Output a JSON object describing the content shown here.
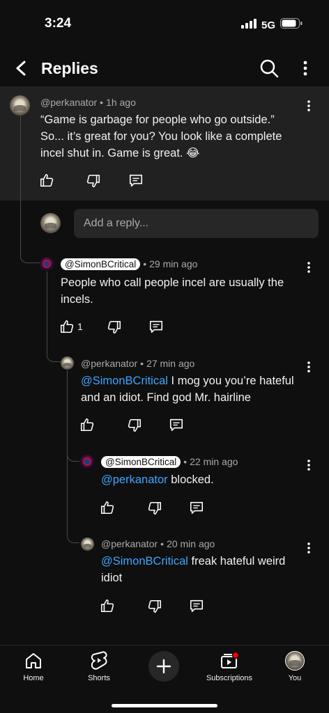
{
  "status": {
    "time": "3:24",
    "network": "5G"
  },
  "header": {
    "title": "Replies"
  },
  "top_comment": {
    "author": "@perkanator",
    "time": "1h ago",
    "lines": [
      "“Game is garbage for people who go outside.”",
      "So... it’s great for you? You look like a complete",
      "incel shut in. Game is great. 😂"
    ]
  },
  "reply_input": {
    "placeholder": "Add a reply..."
  },
  "replies": [
    {
      "author": "@SimonBCritical",
      "time": "29 min ago",
      "lines": [
        "People who call people incel are usually the",
        "incels."
      ],
      "likes": "1"
    },
    {
      "author": "@perkanator",
      "time": "27 min ago",
      "mention": "@SimonBCritical",
      "line1_rest": " I mog you you’re hateful",
      "line2": "and an idiot. Find god Mr. hairline"
    },
    {
      "author": "@SimonBCritical",
      "time": "22 min ago",
      "mention": "@perkanator",
      "line1_rest": " blocked."
    },
    {
      "author": "@perkanator",
      "time": "20 min ago",
      "mention": "@SimonBCritical",
      "line1_rest": " freak hateful weird",
      "line2": "idiot"
    }
  ],
  "nav": {
    "home": "Home",
    "shorts": "Shorts",
    "subscriptions": "Subscriptions",
    "you": "You"
  },
  "colors": {
    "background": "#0f0f0f",
    "highlight": "#212121",
    "mention": "#3ea6ff",
    "notification": "#ff0000"
  }
}
